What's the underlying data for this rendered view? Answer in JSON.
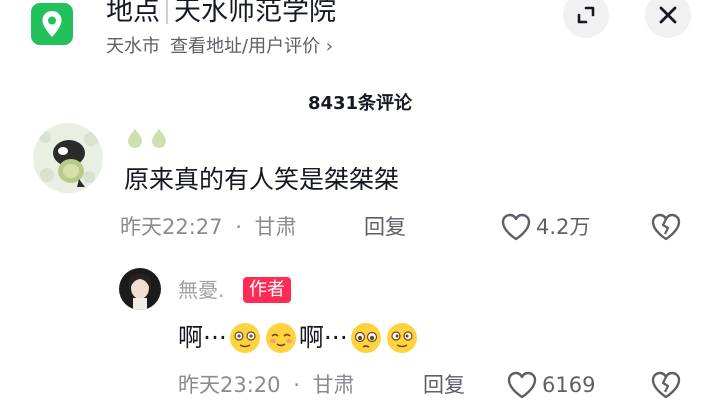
{
  "location": {
    "label": "地点",
    "name": "天水师范学院",
    "city": "天水市",
    "links": "查看地址/用户评价 ›"
  },
  "comments_header": {
    "count_label": "8431条评论"
  },
  "comments": [
    {
      "text": "原来真的有人笑是桀桀桀",
      "time": "昨天22:27",
      "region": "甘肃",
      "reply_label": "回复",
      "likes": "4.2万"
    }
  ],
  "reply": {
    "username": "無憂.",
    "badge": "作者",
    "text_parts": [
      "啊···",
      "啊···"
    ],
    "time": "昨天23:20",
    "region": "甘肃",
    "reply_label": "回复",
    "likes": "6169"
  },
  "colors": {
    "location_badge": "#21c15b",
    "author_badge": "#fe2c55",
    "muted_text": "#8a8b91"
  },
  "icons": [
    "location-pin-icon",
    "expand-icon",
    "close-icon",
    "heart-outline-icon",
    "broken-heart-icon",
    "emoji-icon"
  ]
}
